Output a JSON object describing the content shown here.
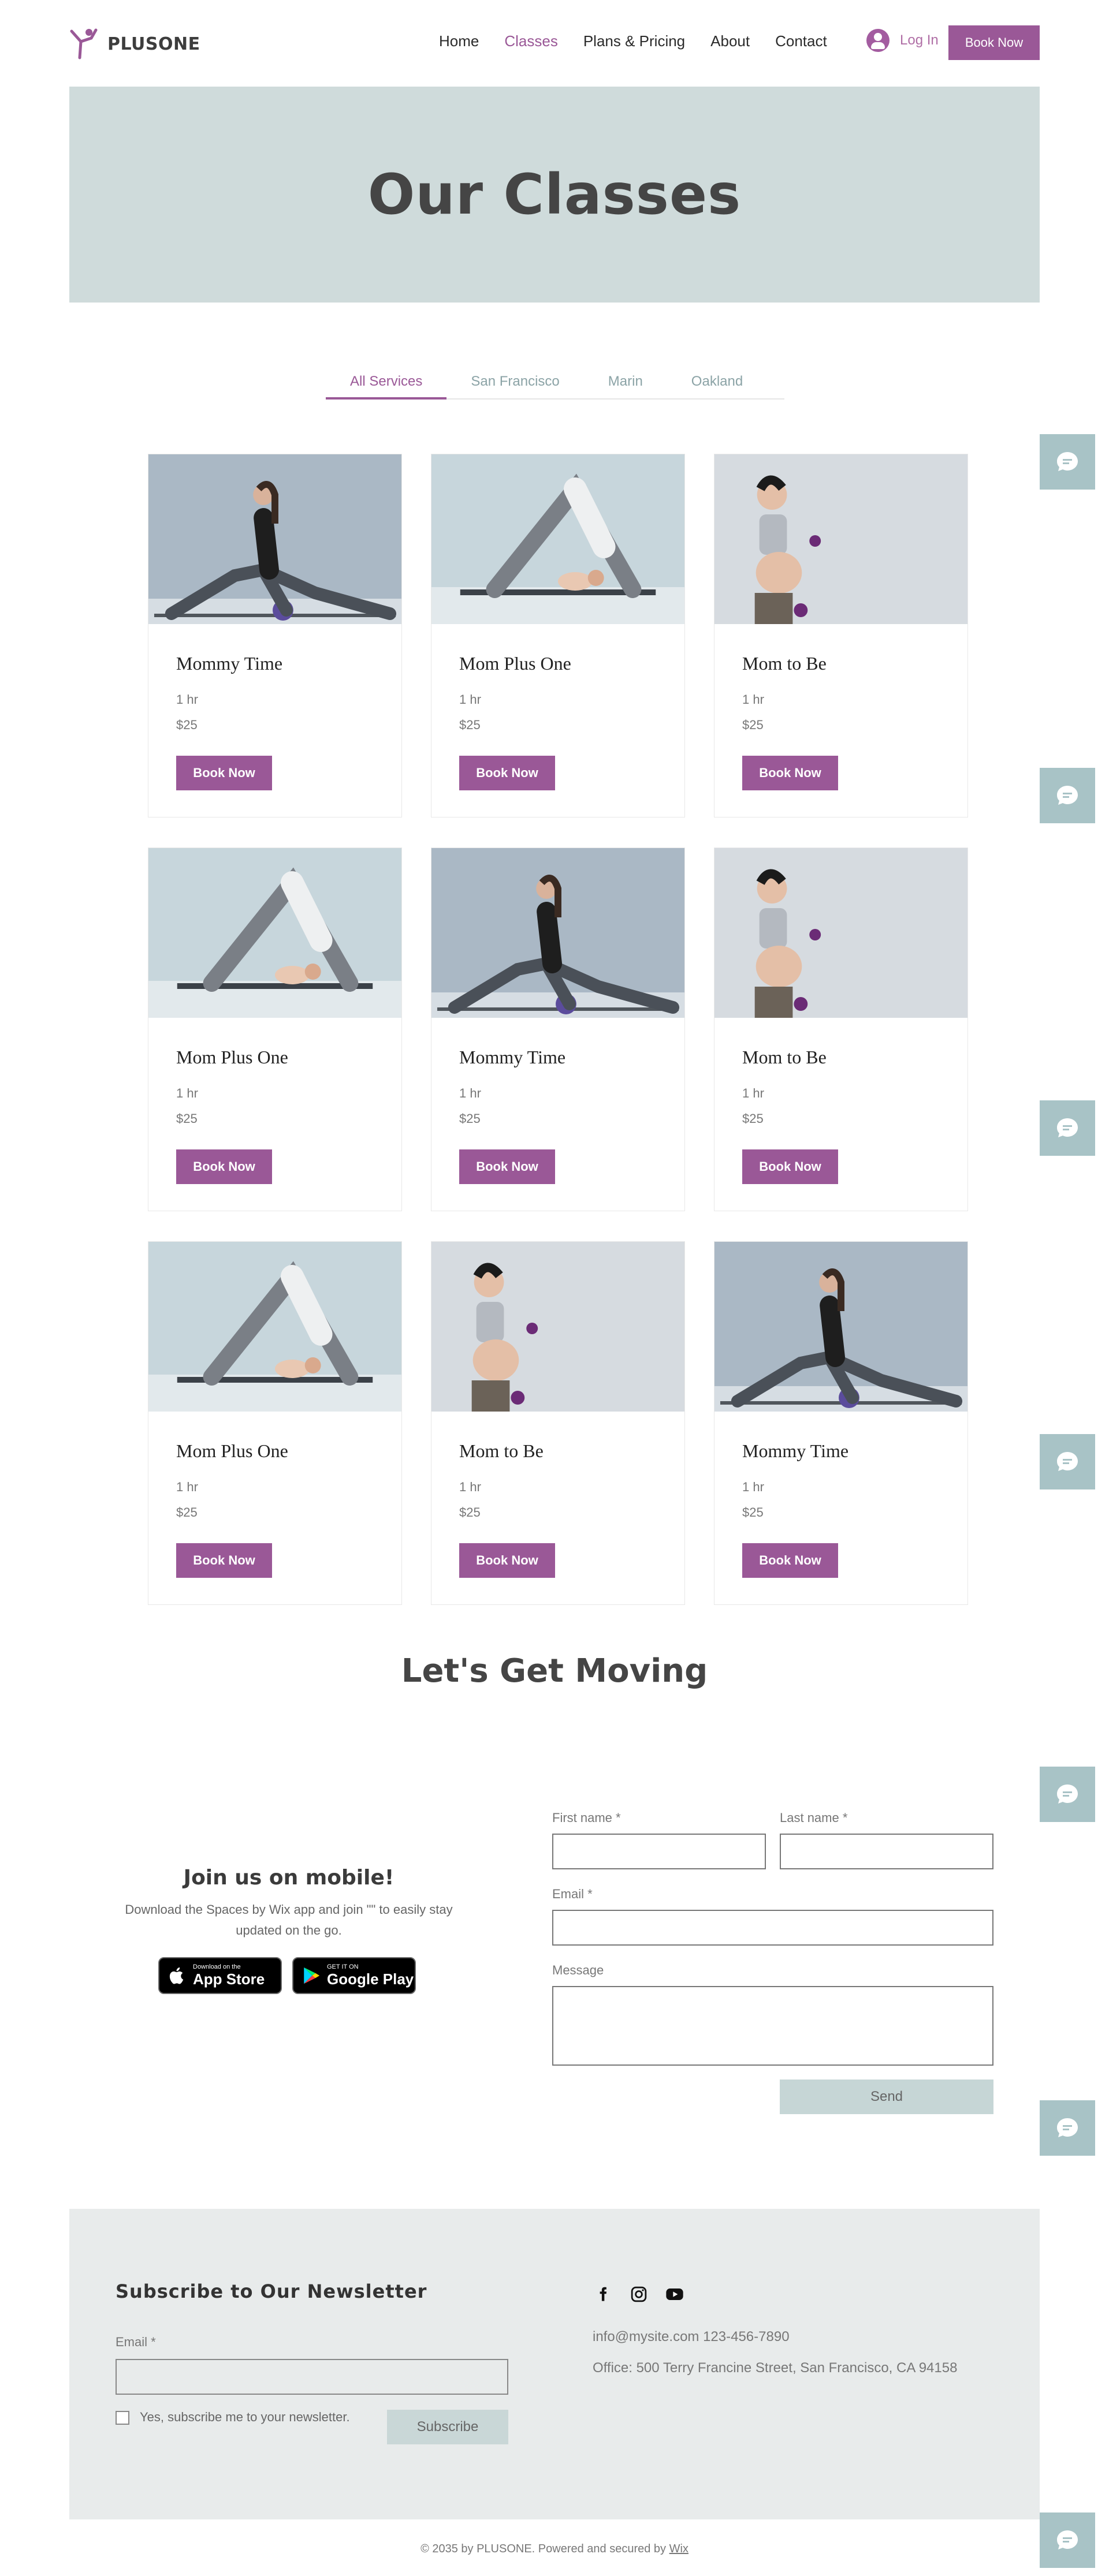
{
  "header": {
    "brand": "PLUSONE",
    "nav": [
      "Home",
      "Classes",
      "Plans & Pricing",
      "About",
      "Contact"
    ],
    "active_nav": "Classes",
    "login_label": "Log In",
    "book_label": "Book Now"
  },
  "hero": {
    "title": "Our Classes"
  },
  "tabs": {
    "items": [
      "All Services",
      "San Francisco",
      "Marin",
      "Oakland"
    ],
    "active": "All Services"
  },
  "classes": [
    {
      "title": "Mommy Time",
      "duration": "1 hr",
      "price": "$25",
      "button": "Book Now",
      "image": "lunge-pose"
    },
    {
      "title": "Mom Plus One",
      "duration": "1 hr",
      "price": "$25",
      "button": "Book Now",
      "image": "downward-dog-baby"
    },
    {
      "title": "Mom to Be",
      "duration": "1 hr",
      "price": "$25",
      "button": "Book Now",
      "image": "pregnant-dumbbell"
    },
    {
      "title": "Mom Plus One",
      "duration": "1 hr",
      "price": "$25",
      "button": "Book Now",
      "image": "downward-dog-baby"
    },
    {
      "title": "Mommy Time",
      "duration": "1 hr",
      "price": "$25",
      "button": "Book Now",
      "image": "lunge-pose"
    },
    {
      "title": "Mom to Be",
      "duration": "1 hr",
      "price": "$25",
      "button": "Book Now",
      "image": "pregnant-dumbbell"
    },
    {
      "title": "Mom Plus One",
      "duration": "1 hr",
      "price": "$25",
      "button": "Book Now",
      "image": "downward-dog-baby"
    },
    {
      "title": "Mom to Be",
      "duration": "1 hr",
      "price": "$25",
      "button": "Book Now",
      "image": "pregnant-dumbbell"
    },
    {
      "title": "Mommy Time",
      "duration": "1 hr",
      "price": "$25",
      "button": "Book Now",
      "image": "lunge-pose"
    }
  ],
  "moving": {
    "title": "Let's Get Moving",
    "mobile_title": "Join us on mobile!",
    "mobile_desc_1": "Download the Spaces by Wix app and join \"\" to easily stay",
    "mobile_desc_2": "updated on the go.",
    "appstore_small": "Download on the",
    "appstore_big": "App Store",
    "googleplay_small": "GET IT ON",
    "googleplay_big": "Google Play"
  },
  "contact_form": {
    "first_name_label": "First name *",
    "last_name_label": "Last name *",
    "email_label": "Email *",
    "message_label": "Message",
    "send_label": "Send"
  },
  "footer": {
    "newsletter_title": "Subscribe to Our Newsletter",
    "email_label": "Email *",
    "checkbox_label": "Yes, subscribe me to your newsletter.",
    "subscribe_label": "Subscribe",
    "social": [
      "facebook-icon",
      "instagram-icon",
      "youtube-icon"
    ],
    "contact_line": "info@mysite.com  123-456-7890",
    "office_line": "Office: 500 Terry Francine Street, San Francisco, CA 94158",
    "copyright": "© 2035 by PLUSONE. Powered and secured by",
    "copyright_link": "Wix"
  },
  "colors": {
    "accent": "#9a5897",
    "hero_bg": "#cfdbdb",
    "chat_bg": "#a8c3c6",
    "footer_bg": "#e8ebeb"
  }
}
